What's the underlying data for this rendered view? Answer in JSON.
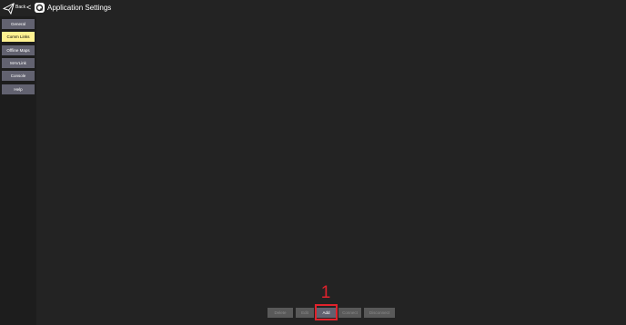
{
  "header": {
    "back_label": "Back",
    "back_chevron": "<",
    "title": "Application Settings",
    "icons": {
      "back_icon": "paper-plane-icon",
      "logo_icon": "qgc-logo-icon"
    }
  },
  "sidebar": {
    "items": [
      {
        "label": "General",
        "active": false
      },
      {
        "label": "Comm Links",
        "active": true
      },
      {
        "label": "Offline Maps",
        "active": false
      },
      {
        "label": "MAVLink",
        "active": false
      },
      {
        "label": "Console",
        "active": false
      },
      {
        "label": "Help",
        "active": false
      }
    ]
  },
  "bottom_buttons": {
    "delete": {
      "label": "Delete",
      "enabled": false
    },
    "edit": {
      "label": "Edit",
      "enabled": false
    },
    "add": {
      "label": "Add",
      "enabled": true
    },
    "connect": {
      "label": "Connect",
      "enabled": false
    },
    "disconnect": {
      "label": "Disconnect",
      "enabled": false
    }
  },
  "annotation": {
    "number": "1"
  },
  "colors": {
    "background": "#232323",
    "sidebar_button": "#626270",
    "active_button": "#fff291",
    "disabled_button": "#595959",
    "annotation_red": "#e0222c"
  }
}
